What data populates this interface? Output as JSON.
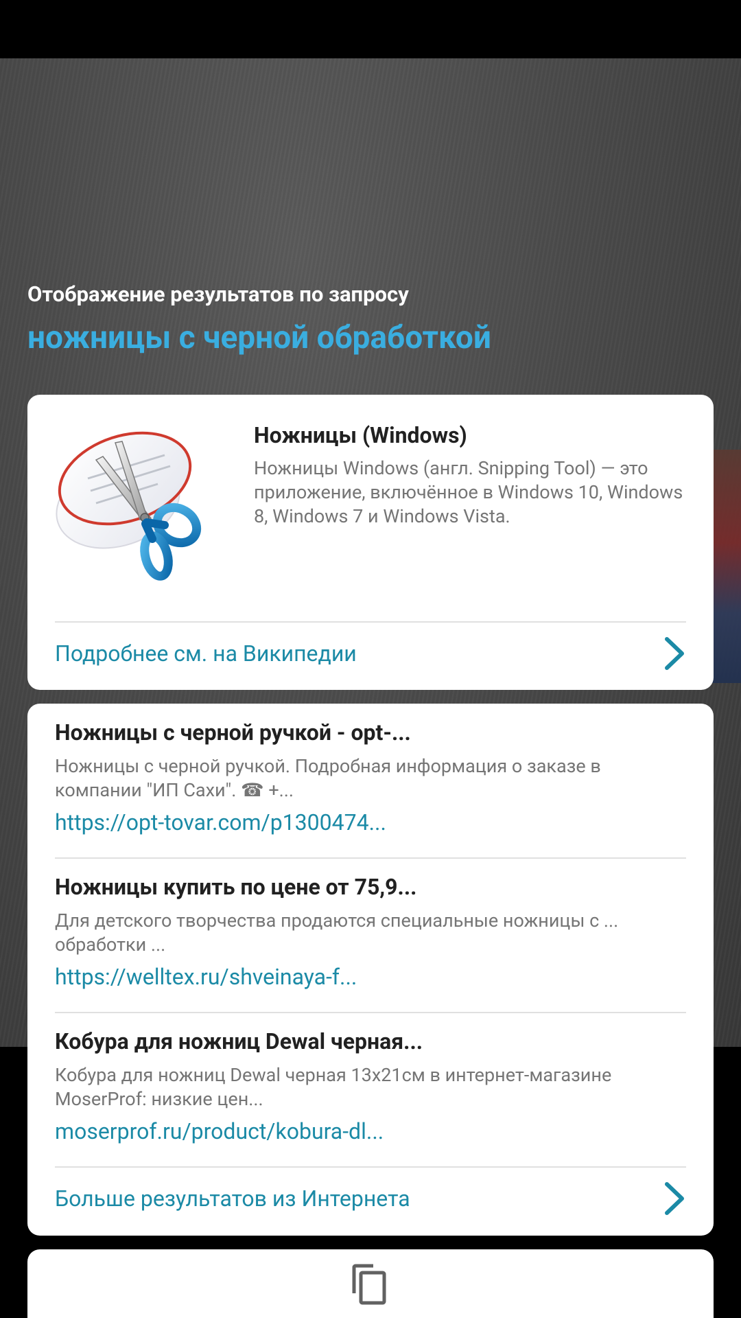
{
  "header": {
    "subtitle": "Отображение результатов по запросу",
    "query": "ножницы с черной обработкой"
  },
  "wiki_card": {
    "image_icon": "snipping-tool-icon",
    "title": "Ножницы (Windows)",
    "description": "Ножницы Windows (англ. Snipping Tool) — это приложение, включённое в Windows 10, Windows 8, Windows 7 и Windows Vista.",
    "more_link": "Подробнее см. на Википедии"
  },
  "results": [
    {
      "title": "Ножницы с черной ручкой - opt-...",
      "snippet": "Ножницы с черной ручкой. Подробная информация о заказе в компании \"ИП Сахи\". ☎ +...",
      "url": "https://opt-tovar.com/p1300474..."
    },
    {
      "title": "Ножницы купить по цене от 75,9...",
      "snippet": "Для детского творчества продаются специальные ножницы с ... обработки ...",
      "url": "https://welltex.ru/shveinaya-f..."
    },
    {
      "title": "Кобура для ножниц Dewal черная...",
      "snippet": "Кобура для ножниц Dewal черная 13х21см в интернет-магазине MoserProf: низкие цен...",
      "url": "moserprof.ru/product/kobura-dl..."
    }
  ],
  "more_results_link": "Больше результатов из Интернета",
  "icons": {
    "chevron": "chevron-right-icon",
    "copy": "copy-icon"
  },
  "colors": {
    "accent": "#1b8aa6",
    "query": "#3aaee0",
    "title": "#212121",
    "snippet": "#757575"
  }
}
